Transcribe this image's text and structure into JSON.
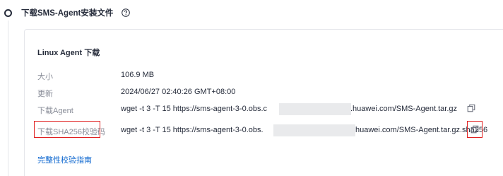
{
  "step": {
    "title": "下载SMS-Agent安装文件",
    "help_icon": "question-circle-icon"
  },
  "card": {
    "title": "Linux Agent 下载",
    "rows": [
      {
        "label": "大小",
        "value": "106.9 MB"
      },
      {
        "label": "更新",
        "value": "2024/06/27 02:40:26 GMT+08:00"
      }
    ],
    "agent": {
      "label": "下载Agent",
      "cmd_prefix": "wget -t 3 -T 15 https://sms-agent-3-0.obs.c",
      "cmd_suffix": ".huawei.com/SMS-Agent.tar.gz",
      "copy_icon": "copy-icon"
    },
    "sha": {
      "label": "下载SHA256校验码",
      "cmd_prefix": "wget -t 3 -T 15 https://sms-agent-3-0.obs.",
      "cmd_suffix": "huawei.com/SMS-Agent.tar.gz.sha256",
      "copy_icon": "copy-icon"
    },
    "link": "完整性校验指南"
  },
  "colors": {
    "highlight": "#e02020",
    "link": "#0a65cf",
    "label": "#8a8e99",
    "text": "#252b3a"
  }
}
